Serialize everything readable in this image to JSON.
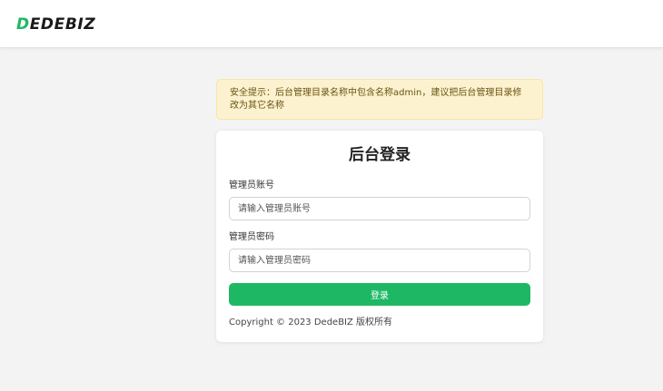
{
  "header": {
    "logo_first": "D",
    "logo_rest": "EDEBIZ"
  },
  "alert": {
    "text": "安全提示：后台管理目录名称中包含名称admin，建议把后台管理目录修改为其它名称"
  },
  "login": {
    "title": "后台登录",
    "username_label": "管理员账号",
    "username_placeholder": "请输入管理员账号",
    "username_value": "",
    "password_label": "管理员密码",
    "password_placeholder": "请输入管理员密码",
    "password_value": "",
    "submit_label": "登录",
    "copyright": "Copyright © 2023 DedeBIZ 版权所有"
  },
  "colors": {
    "brand": "#1eb864",
    "alert_bg": "#fcf2cf",
    "alert_text": "#6b5412"
  }
}
